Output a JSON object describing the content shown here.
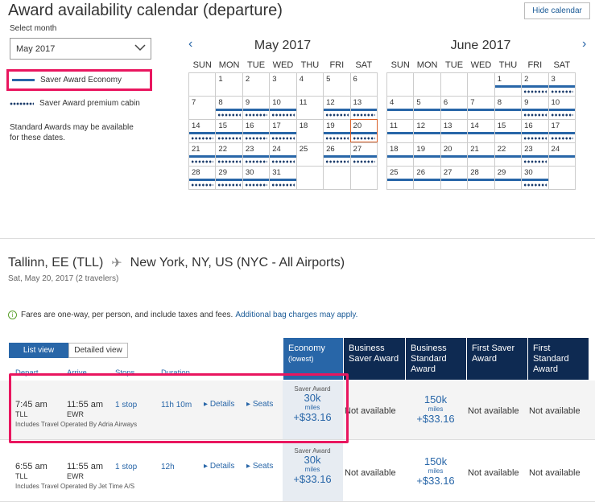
{
  "header": {
    "title": "Award availability calendar (departure)",
    "hide_calendar": "Hide calendar"
  },
  "month_select": {
    "label": "Select month",
    "value": "May 2017"
  },
  "legend": {
    "economy": "Saver Award Economy",
    "premium": "Saver Award premium cabin",
    "note": "Standard Awards may be available for these dates."
  },
  "calendar": {
    "weekdays": [
      "SUN",
      "MON",
      "TUE",
      "WED",
      "THU",
      "FRI",
      "SAT"
    ],
    "months": [
      {
        "title": "May 2017",
        "selected_day": 20,
        "weeks": [
          [
            null,
            {
              "d": 1
            },
            {
              "d": 2
            },
            {
              "d": 3
            },
            {
              "d": 4
            },
            {
              "d": 5
            },
            {
              "d": 6
            }
          ],
          [
            {
              "d": 7
            },
            {
              "d": 8,
              "e": 1,
              "p": 1
            },
            {
              "d": 9,
              "e": 1,
              "p": 1
            },
            {
              "d": 10,
              "e": 1,
              "p": 1
            },
            {
              "d": 11
            },
            {
              "d": 12,
              "e": 1,
              "p": 1
            },
            {
              "d": 13,
              "e": 1,
              "p": 1
            }
          ],
          [
            {
              "d": 14,
              "e": 1,
              "p": 1
            },
            {
              "d": 15,
              "e": 1,
              "p": 1
            },
            {
              "d": 16,
              "e": 1,
              "p": 1
            },
            {
              "d": 17,
              "e": 1,
              "p": 1
            },
            {
              "d": 18
            },
            {
              "d": 19,
              "e": 1,
              "p": 1
            },
            {
              "d": 20,
              "e": 1,
              "p": 1
            }
          ],
          [
            {
              "d": 21,
              "e": 1,
              "p": 1
            },
            {
              "d": 22,
              "e": 1,
              "p": 1
            },
            {
              "d": 23,
              "e": 1,
              "p": 1
            },
            {
              "d": 24,
              "e": 1,
              "p": 1
            },
            {
              "d": 25
            },
            {
              "d": 26,
              "e": 1,
              "p": 1
            },
            {
              "d": 27,
              "e": 1,
              "p": 1
            }
          ],
          [
            {
              "d": 28,
              "e": 1,
              "p": 1
            },
            {
              "d": 29,
              "e": 1,
              "p": 1
            },
            {
              "d": 30,
              "e": 1,
              "p": 1
            },
            {
              "d": 31,
              "e": 1,
              "p": 1
            },
            null,
            null,
            null
          ]
        ]
      },
      {
        "title": "June 2017",
        "weeks": [
          [
            null,
            null,
            null,
            null,
            {
              "d": 1,
              "e": 1
            },
            {
              "d": 2,
              "e": 1,
              "p": 1
            },
            {
              "d": 3,
              "e": 1,
              "p": 1
            }
          ],
          [
            {
              "d": 4,
              "e": 1
            },
            {
              "d": 5,
              "e": 1
            },
            {
              "d": 6,
              "e": 1
            },
            {
              "d": 7,
              "e": 1
            },
            {
              "d": 8,
              "e": 1
            },
            {
              "d": 9,
              "e": 1,
              "p": 1
            },
            {
              "d": 10,
              "e": 1,
              "p": 1
            }
          ],
          [
            {
              "d": 11,
              "e": 1
            },
            {
              "d": 12,
              "e": 1
            },
            {
              "d": 13,
              "e": 1
            },
            {
              "d": 14,
              "e": 1
            },
            {
              "d": 15,
              "e": 1
            },
            {
              "d": 16,
              "e": 1,
              "p": 1
            },
            {
              "d": 17,
              "e": 1,
              "p": 1
            }
          ],
          [
            {
              "d": 18,
              "e": 1
            },
            {
              "d": 19,
              "e": 1
            },
            {
              "d": 20,
              "e": 1
            },
            {
              "d": 21,
              "e": 1
            },
            {
              "d": 22,
              "e": 1
            },
            {
              "d": 23,
              "e": 1,
              "p": 1
            },
            {
              "d": 24,
              "e": 1
            }
          ],
          [
            {
              "d": 25,
              "e": 1
            },
            {
              "d": 26,
              "e": 1
            },
            {
              "d": 27,
              "e": 1
            },
            {
              "d": 28,
              "e": 1
            },
            {
              "d": 29,
              "e": 1
            },
            {
              "d": 30,
              "e": 1,
              "p": 1
            },
            null
          ]
        ]
      }
    ]
  },
  "route": {
    "origin": "Tallinn, EE (TLL)",
    "destination": "New York, NY, US (NYC - All Airports)",
    "subtitle": "Sat, May 20, 2017 (2 travelers)"
  },
  "fares_note": {
    "text": "Fares are one-way, per person, and include taxes and fees.",
    "link": "Additional bag charges may apply."
  },
  "view_tabs": [
    "List view",
    "Detailed view"
  ],
  "cabins": [
    {
      "title": "Economy",
      "sub": "(lowest)"
    },
    {
      "title": "Business Saver Award"
    },
    {
      "title": "Business Standard Award"
    },
    {
      "title": "First Saver Award"
    },
    {
      "title": "First Standard Award"
    }
  ],
  "columns": [
    "Depart",
    "Arrive",
    "Stops",
    "Duration"
  ],
  "flights": [
    {
      "depart": "7:45 am",
      "depart_code": "TLL",
      "arrive": "11:55 am",
      "arrive_code": "EWR",
      "stops": "1 stop",
      "duration": "11h 10m",
      "details": "Details",
      "seats": "Seats",
      "operated": "Includes Travel Operated By Adria Airways",
      "economy": {
        "label": "Saver Award",
        "miles": "30k",
        "unit": "miles",
        "tax": "+$33.16"
      },
      "business_saver": "Not available",
      "business_standard": {
        "miles": "150k",
        "unit": "miles",
        "tax": "+$33.16"
      },
      "first_saver": "Not available",
      "first_standard": "Not available"
    },
    {
      "depart": "6:55 am",
      "depart_code": "TLL",
      "arrive": "11:55 am",
      "arrive_code": "EWR",
      "stops": "1 stop",
      "duration": "12h",
      "details": "Details",
      "seats": "Seats",
      "operated": "Includes Travel Operated By Jet Time A/S",
      "economy": {
        "label": "Saver Award",
        "miles": "30k",
        "unit": "miles",
        "tax": "+$33.16"
      },
      "business_saver": "Not available",
      "business_standard": {
        "miles": "150k",
        "unit": "miles",
        "tax": "+$33.16"
      },
      "first_saver": "Not available",
      "first_standard": "Not available"
    }
  ]
}
